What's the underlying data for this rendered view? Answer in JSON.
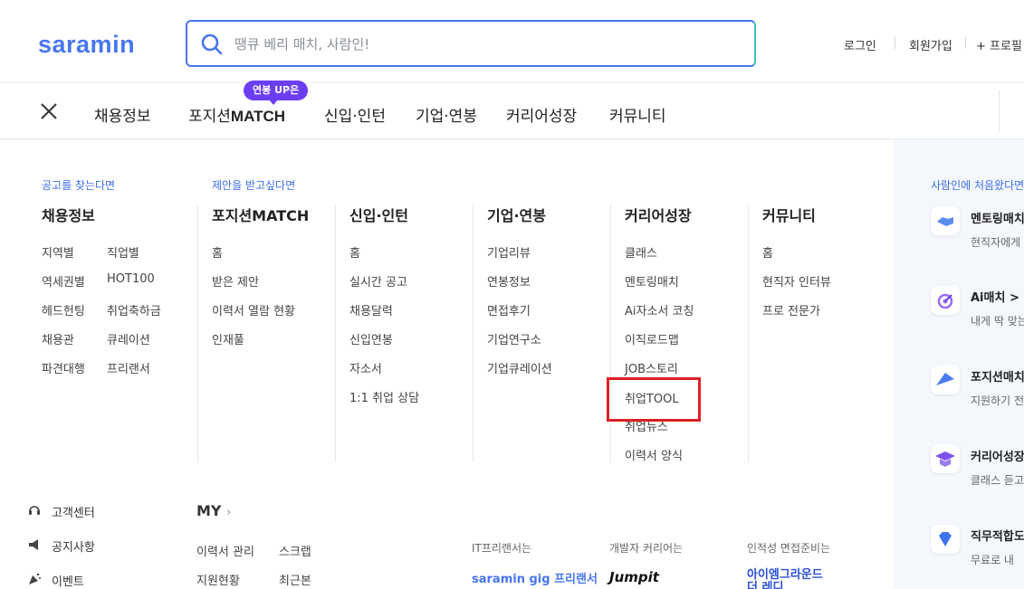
{
  "header": {
    "logo": "saramin",
    "search_placeholder": "땡큐 베리 매치, 사람인!",
    "login": "로그인",
    "signup": "회원가입",
    "profile": "+ 프로필"
  },
  "nav": {
    "badge": "연봉 UP은",
    "items": [
      "채용정보",
      "포지션",
      "MATCH",
      "신입·인턴",
      "기업·연봉",
      "커리어성장",
      "커뮤니티"
    ]
  },
  "menu": {
    "hint1": "공고를 찾는다면",
    "hint2": "제안을 받고싶다면",
    "columns": [
      {
        "title": "채용정보",
        "links": [
          "지역별",
          "직업별",
          "역세권별",
          "HOT100",
          "헤드헌팅",
          "취업축하금",
          "채용관",
          "큐레이션",
          "파견대행",
          "프리랜서"
        ]
      },
      {
        "title": "포지션MATCH",
        "links": [
          "홈",
          "받은 제안",
          "이력서 열람 현황",
          "인재풀"
        ]
      },
      {
        "title": "신입·인턴",
        "links": [
          "홈",
          "실시간 공고",
          "채용달력",
          "신입연봉",
          "자소서",
          "1:1 취업 상담"
        ]
      },
      {
        "title": "기업·연봉",
        "links": [
          "기업리뷰",
          "연봉정보",
          "면접후기",
          "기업연구소",
          "기업큐레이션"
        ]
      },
      {
        "title": "커리어성장",
        "links": [
          "클래스",
          "멘토링매치",
          "Ai자소서 코칭",
          "이직로드맵",
          "JOB스토리",
          "취업TOOL",
          "취업뉴스",
          "이력서 양식"
        ]
      },
      {
        "title": "커뮤니티",
        "links": [
          "홈",
          "현직자 인터뷰",
          "프로 전문가"
        ]
      }
    ]
  },
  "aside": {
    "title": "사람인에 처음왔다면",
    "cards": [
      {
        "title": "멘토링매치",
        "desc": "현직자에게",
        "icon": "handshake-icon",
        "color": "#5b8def"
      },
      {
        "title": "Ai매치 >",
        "desc": "내게 딱 맞는",
        "icon": "target-icon",
        "color": "#9a6cf0"
      },
      {
        "title": "포지션매치",
        "desc": "지원하기 전",
        "icon": "paper-plane-icon",
        "color": "#4a7cf0"
      },
      {
        "title": "커리어성장",
        "desc": "클래스 듣고",
        "icon": "graduation-cap-icon",
        "color": "#7c52e8"
      },
      {
        "title": "직무적합도",
        "desc": "무료로 내",
        "icon": "gem-icon",
        "color": "#3f72ee"
      }
    ]
  },
  "footer": {
    "links": [
      "고객센터",
      "공지사항",
      "이벤트"
    ],
    "my": "MY",
    "my_links": [
      "이력서 관리",
      "스크랩",
      "지원현황",
      "최근본"
    ],
    "promos": [
      {
        "label": "IT프리랜서는",
        "logo": "saramin gig 프리랜서"
      },
      {
        "label": "개발자 커리어는",
        "logo": "Jumpit"
      },
      {
        "label": "인적성 면접준비는",
        "logo": "아이엠그라운드 더 레디"
      }
    ]
  }
}
